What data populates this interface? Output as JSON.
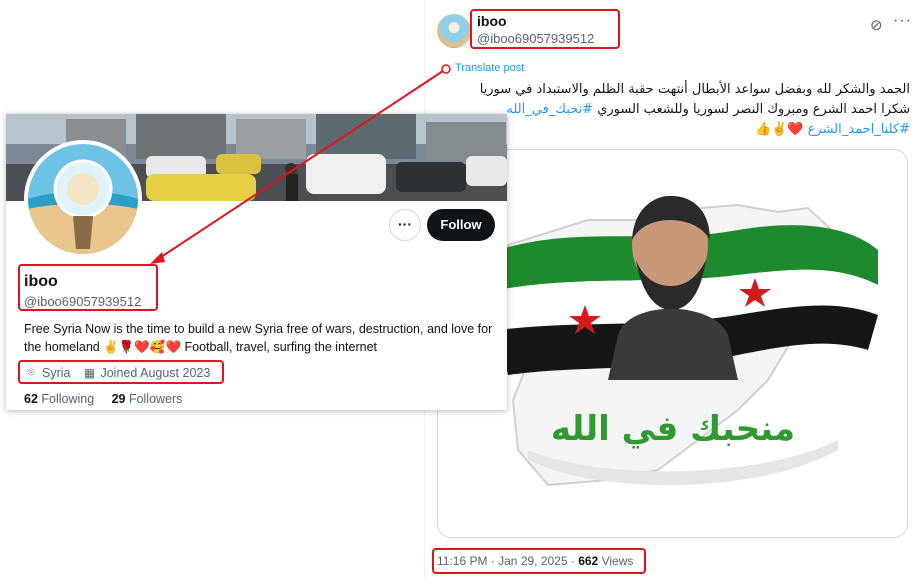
{
  "tweet": {
    "name": "iboo",
    "handle": "@iboo69057939512",
    "translate": "Translate post",
    "line1": "الحمد والشكر لله وبفضل سواعد الأبطال أنتهت حقبة الظلم والاستبداد في سوريا",
    "line2_text": "شكرا احمد الشرع ومبروك النصر لسوريا وللشعب السوري ",
    "line2_tag": "#نحبك_في_الله",
    "line3_tag": "#كلنا_احمد_الشرع",
    "line3_emoji": " ❤️✌️👍",
    "image_caption": "منحبك في الله",
    "time": "11:16 PM · Jan 29, 2025 · ",
    "views_count": "662",
    "views_label": " Views"
  },
  "profile": {
    "name": "iboo",
    "handle": "@iboo69057939512",
    "follow_label": "Follow",
    "more_label": "···",
    "bio_text": "Free Syria Now is the time to build a new Syria free of wars, destruction, and love for the homeland ",
    "bio_emoji": "✌️🌹❤️🥰❤️",
    "bio_tail": " Football, travel, surfing the internet",
    "location": "Syria",
    "joined": "Joined August 2023",
    "following_count": "62",
    "following_label": " Following",
    "followers_count": "29",
    "followers_label": " Followers"
  },
  "icons": [
    "grok-icon",
    "more-icon",
    "location-icon",
    "calendar-icon"
  ],
  "colors": {
    "annotation": "#e0141e",
    "link": "#1d9bf0",
    "secondary_text": "#536471"
  }
}
